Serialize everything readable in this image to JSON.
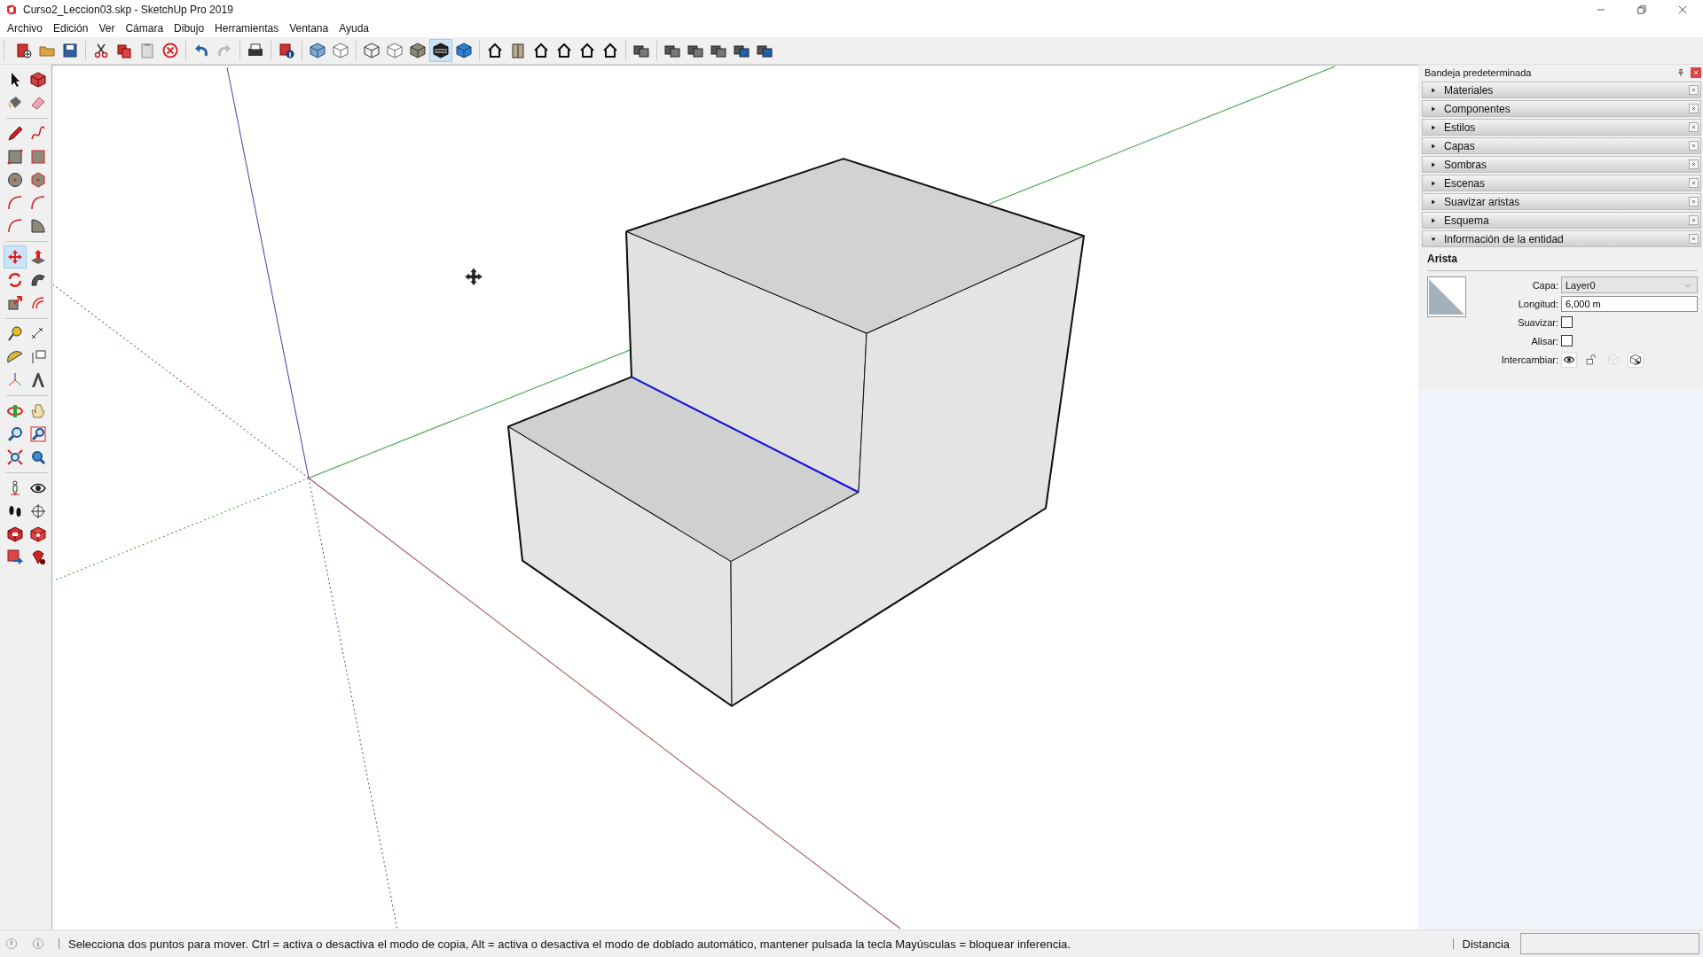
{
  "window": {
    "title": "Curso2_Leccion03.skp - SketchUp Pro 2019"
  },
  "menu": [
    "Archivo",
    "Edición",
    "Ver",
    "Cámara",
    "Dibujo",
    "Herramientas",
    "Ventana",
    "Ayuda"
  ],
  "toolbar": {
    "groups": [
      [
        {
          "selected": false
        },
        {
          "selected": false
        },
        {
          "selected": false
        }
      ],
      [
        {
          "selected": false
        },
        {
          "selected": false
        },
        {
          "selected": false
        },
        {
          "selected": false
        }
      ],
      [
        {
          "selected": false
        },
        {
          "selected": false
        }
      ],
      [
        {
          "selected": false
        }
      ],
      [
        {
          "selected": false
        }
      ],
      [
        {
          "selected": false
        },
        {
          "selected": false
        }
      ],
      [
        {
          "selected": false
        },
        {
          "selected": false
        },
        {
          "selected": false
        },
        {
          "selected": true
        },
        {
          "selected": false
        }
      ],
      [
        {
          "selected": false
        },
        {
          "selected": false
        },
        {
          "selected": false
        },
        {
          "selected": false
        },
        {
          "selected": false
        },
        {
          "selected": false
        }
      ],
      [
        {
          "selected": false
        }
      ],
      [
        {
          "selected": false
        },
        {
          "selected": false
        },
        {
          "selected": false
        },
        {
          "selected": false
        },
        {
          "selected": false
        }
      ]
    ]
  },
  "tools": {
    "groups": [
      [
        {
          "selected": false
        },
        {
          "selected": false
        },
        {
          "selected": false
        },
        {
          "selected": false
        }
      ],
      [
        {
          "selected": false
        },
        {
          "selected": false
        },
        {
          "selected": false
        },
        {
          "selected": false
        },
        {
          "selected": false
        },
        {
          "selected": false
        },
        {
          "selected": false
        },
        {
          "selected": false
        },
        {
          "selected": false
        },
        {
          "selected": false
        }
      ],
      [
        {
          "selected": true
        },
        {
          "selected": false
        },
        {
          "selected": false
        },
        {
          "selected": false
        },
        {
          "selected": false
        },
        {
          "selected": false
        }
      ],
      [
        {
          "selected": false
        },
        {
          "selected": false
        },
        {
          "selected": false
        },
        {
          "selected": false
        },
        {
          "selected": false
        },
        {
          "selected": false
        }
      ],
      [
        {
          "selected": false
        },
        {
          "selected": false
        },
        {
          "selected": false
        },
        {
          "selected": false
        },
        {
          "selected": false
        },
        {
          "selected": false
        }
      ],
      [
        {
          "selected": false
        },
        {
          "selected": false
        },
        {
          "selected": false
        },
        {
          "selected": false
        },
        {
          "selected": false
        },
        {
          "selected": false
        },
        {
          "selected": false
        },
        {
          "selected": false
        }
      ]
    ]
  },
  "tray": {
    "title": "Bandeja predeterminada",
    "panels": [
      {
        "label": "Materiales",
        "expanded": false
      },
      {
        "label": "Componentes",
        "expanded": false
      },
      {
        "label": "Estilos",
        "expanded": false
      },
      {
        "label": "Capas",
        "expanded": false
      },
      {
        "label": "Sombras",
        "expanded": false
      },
      {
        "label": "Escenas",
        "expanded": false
      },
      {
        "label": "Suavizar aristas",
        "expanded": false
      },
      {
        "label": "Esquema",
        "expanded": false
      },
      {
        "label": "Información de la entidad",
        "expanded": true
      }
    ],
    "entity_info": {
      "heading": "Arista",
      "fields": [
        {
          "kind": "dropdown",
          "label": "Capa:",
          "value": "Layer0"
        },
        {
          "kind": "text",
          "label": "Longitud:",
          "value": "6,000 m"
        },
        {
          "kind": "checkbox",
          "label": "Suavizar:",
          "checked": false
        },
        {
          "kind": "checkbox",
          "label": "Alisar:",
          "checked": false
        },
        {
          "kind": "toggles",
          "label": "Intercambiar:",
          "toggles": [
            {
              "on": true,
              "disabled": false
            },
            {
              "on": false,
              "disabled": false
            },
            {
              "on": false,
              "disabled": true
            },
            {
              "on": true,
              "disabled": false
            }
          ]
        }
      ]
    }
  },
  "status_bar": {
    "message": "Selecciona dos puntos para mover. Ctrl = activa o desactiva el modo de copia, Alt = activa o desactiva el modo de doblado automático, mantener pulsada la tecla Mayúsculas = bloquear inferencia.",
    "measure_label": "Distancia"
  }
}
